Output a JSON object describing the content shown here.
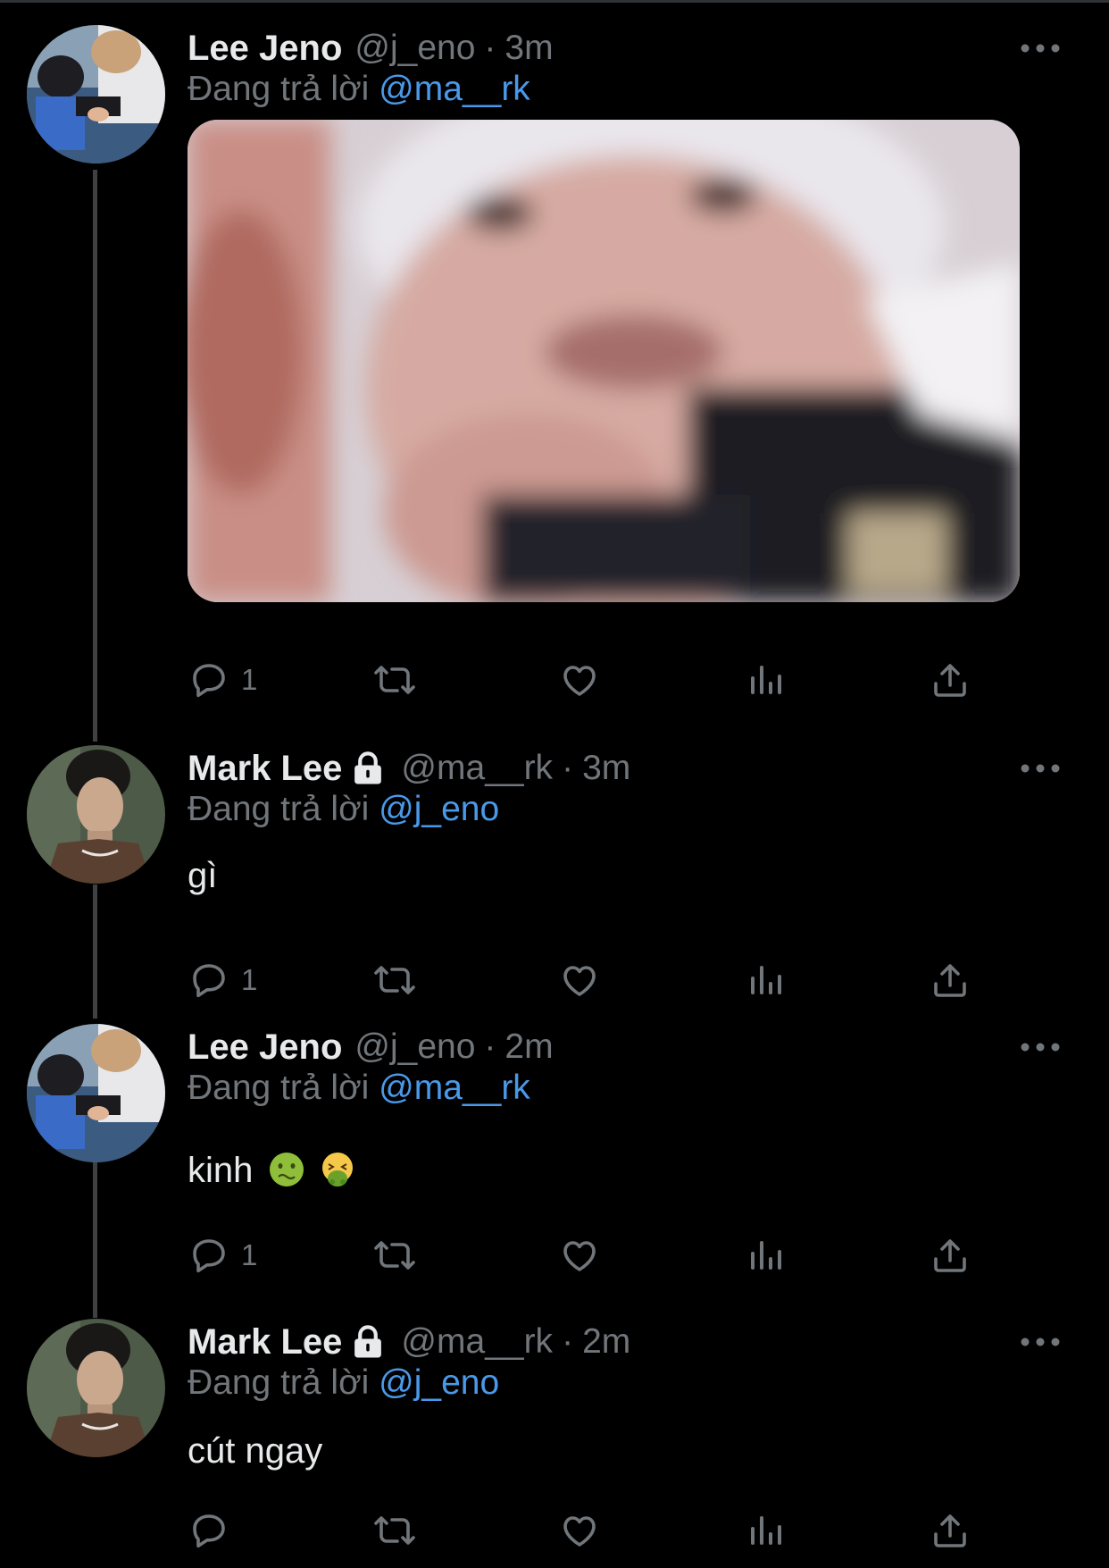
{
  "thread": [
    {
      "name": "Lee Jeno",
      "verified_lock": false,
      "handle": "@j_eno",
      "separator": "·",
      "time": "3m",
      "reply_prefix": "Đang trả lời",
      "reply_to": "@ma__rk",
      "text": "",
      "has_media": true,
      "actions": {
        "reply_count": "1",
        "retweet_count": "",
        "like_count": ""
      }
    },
    {
      "name": "Mark Lee",
      "verified_lock": true,
      "handle": "@ma__rk",
      "separator": "·",
      "time": "3m",
      "reply_prefix": "Đang trả lời",
      "reply_to": "@j_eno",
      "text": "gì",
      "has_media": false,
      "actions": {
        "reply_count": "1",
        "retweet_count": "",
        "like_count": ""
      }
    },
    {
      "name": "Lee Jeno",
      "verified_lock": false,
      "handle": "@j_eno",
      "separator": "·",
      "time": "2m",
      "reply_prefix": "Đang trả lời",
      "reply_to": "@ma__rk",
      "text": "kinh",
      "emojis": [
        "nauseated-face",
        "vomiting-face"
      ],
      "has_media": false,
      "actions": {
        "reply_count": "1",
        "retweet_count": "",
        "like_count": ""
      }
    },
    {
      "name": "Mark Lee",
      "verified_lock": true,
      "handle": "@ma__rk",
      "separator": "·",
      "time": "2m",
      "reply_prefix": "Đang trả lời",
      "reply_to": "@j_eno",
      "text": "cút ngay",
      "has_media": false,
      "actions": {
        "reply_count": "",
        "retweet_count": "",
        "like_count": ""
      }
    }
  ],
  "icons": {
    "reply": "reply-icon",
    "retweet": "retweet-icon",
    "like": "heart-icon",
    "views": "views-icon",
    "share": "share-icon",
    "more": "more-icon",
    "lock": "lock-icon"
  },
  "colors": {
    "background": "#000000",
    "text": "#e7e9ea",
    "muted": "#71767b",
    "mention": "#4a99e9",
    "thread_line": "#3e4144"
  }
}
